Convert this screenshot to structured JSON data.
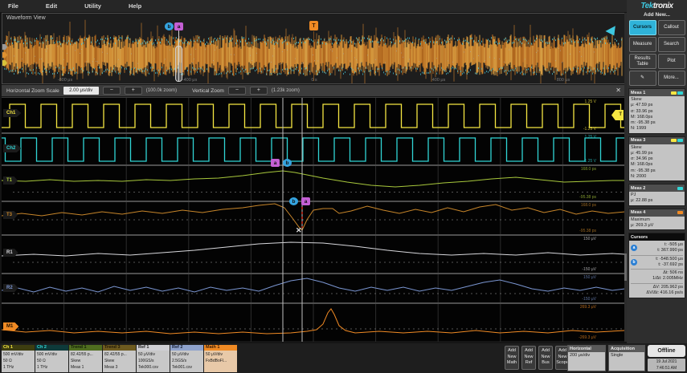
{
  "menu": {
    "items": [
      "File",
      "Edit",
      "Utility",
      "Help"
    ]
  },
  "overview": {
    "title": "Waveform View",
    "time_labels": [
      "-800 μs",
      "-400 μs",
      "0 s",
      "400 μs",
      "800 μs"
    ],
    "cursor_a": "a",
    "cursor_b": "b",
    "trigger_label": "T"
  },
  "zoom_bar": {
    "h_label": "Horizontal Zoom Scale",
    "h_value": "2.00 μs/div",
    "minus": "−",
    "plus": "+",
    "h_zoom": "(100.0k zoom)",
    "v_label": "Vertical Zoom",
    "v_zoom": "(1.23k zoom)",
    "close": "✕"
  },
  "channels": {
    "rows": [
      {
        "badge": "Ch1",
        "color": "#f5e642",
        "top_label": "1.25 V",
        "bottom_label": "-1.25 V"
      },
      {
        "badge": "Ch2",
        "color": "#30d5d5",
        "top_label": "1.25 V",
        "bottom_label": "-1.25 V"
      },
      {
        "badge": "T1",
        "color": "#a8c83c",
        "top_label": "168.0 ps",
        "bottom_label": "-95.38 ps"
      },
      {
        "badge": "T3",
        "color": "#c8862a",
        "top_label": "168.0 ps",
        "bottom_label": "-95.38 ps"
      },
      {
        "badge": "R1",
        "color": "#d8d8dc",
        "top_label": "150 μV",
        "bottom_label": "-150 μV"
      },
      {
        "badge": "R2",
        "color": "#7b96d2",
        "top_label": "150 μV",
        "bottom_label": "-150 μV"
      },
      {
        "badge": "M1",
        "color": "#f08a24",
        "top_label": "269.3 μV",
        "bottom_label": "-269.3 μV"
      }
    ],
    "trigger_arrow": "T",
    "x_marker": "✕"
  },
  "sidebar": {
    "brand_left": "Tek",
    "brand_right": "tronix",
    "add_new_label": "Add New...",
    "buttons": [
      "Cursors",
      "Callout",
      "Measure",
      "Search",
      "Results Table",
      "Plot",
      "More..."
    ],
    "draw_icon": "✎",
    "meas_panels": [
      {
        "name": "Meas 1",
        "chips": [
          "#f5e642",
          "#30d5d5"
        ],
        "lines": [
          "Skew",
          "μ: 47.59 ps",
          "σ: 33.96 ps",
          "M: 168.0ps",
          "m: -95.38 ps",
          "N: 1999"
        ]
      },
      {
        "name": "Meas 3",
        "chips": [
          "#f5e642",
          "#30d5d5"
        ],
        "lines": [
          "Skew",
          "μ: 45.99 ps",
          "σ: 34.96 ps",
          "M: 168.0ps",
          "m: -95.38 ps",
          "N: 2000"
        ]
      },
      {
        "name": "Meas 2",
        "chips": [
          "#30d5d5"
        ],
        "lines": [
          "PJ",
          "μ: 22.88 ps"
        ]
      },
      {
        "name": "Meas 4",
        "chips": [
          "#f08a24"
        ],
        "lines": [
          "Maximum",
          "μ: 269.3 μV"
        ]
      }
    ],
    "cursors_panel": {
      "title": "Cursors",
      "rows": [
        {
          "icon": "a",
          "l1": "t: -505 μs",
          "l2": "t: 367.990 ps"
        },
        {
          "icon": "b",
          "l1": "t: -548.500 μs",
          "l2": "t: -37.692 ps"
        }
      ],
      "deltas": [
        {
          "l1": "Δt: 506 ns",
          "l2": "1/Δt: 2.005MHz"
        },
        {
          "l1": "ΔV: 205.962 ps",
          "l2": "ΔV/Δt: 416.16 ps/s"
        }
      ]
    }
  },
  "bottom": {
    "badges": [
      {
        "title": "Ch 1",
        "head_bg": "#3d3d10",
        "head_fg": "#f5e642",
        "lines": [
          "500 mV/div",
          "50 Ω",
          "1 THz"
        ]
      },
      {
        "title": "Ch 2",
        "head_bg": "#0e3a3a",
        "head_fg": "#30d5d5",
        "lines": [
          "500 mV/div",
          "50 Ω",
          "1 THz"
        ]
      },
      {
        "title": "Trend 1",
        "head_bg": "#4f6d1f",
        "head_fg": "#101c06",
        "lines": [
          "82.42/55 p...",
          "Skew",
          "Meas 1"
        ]
      },
      {
        "title": "Trend 3",
        "head_bg": "#6d5a1f",
        "head_fg": "#201806",
        "lines": [
          "82.42/55 p...",
          "Skew",
          "Meas 3"
        ]
      },
      {
        "title": "Ref 1",
        "head_bg": "#cfcfd4",
        "head_fg": "#202020",
        "lines": [
          "50 μV/div",
          "100GS/s",
          "Tek000.csv"
        ]
      },
      {
        "title": "Ref 2",
        "head_bg": "#8ea2cc",
        "head_fg": "#141e34",
        "lines": [
          "50 μV/div",
          "2.5GS/s",
          "Tek001.csv"
        ]
      },
      {
        "title": "Math 1",
        "head_bg": "#f08a24",
        "head_fg": "#3a1c04",
        "lines": [
          "50 μV/div",
          "FxBdBoFl..."
        ]
      }
    ],
    "add_buttons": [
      "Add New Math",
      "Add New Ref",
      "Add New Bus",
      "Add New Scope"
    ],
    "horizontal": {
      "title": "Horizontal",
      "value": "200 μs/div"
    },
    "acquisition": {
      "title": "Acquisition",
      "value": "Single"
    },
    "offline": "Offline",
    "date": "19 Jul 2021",
    "time": "7:46:51 AM"
  }
}
